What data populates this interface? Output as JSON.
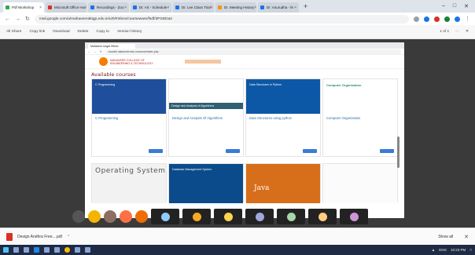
{
  "browser": {
    "tabs": [
      {
        "label": "Pdf Workshop",
        "color": "#34a853"
      },
      {
        "label": "Microsoft Office Hom",
        "color": "#d93025"
      },
      {
        "label": "Recordings - Zoo",
        "color": "#1a73e8"
      },
      {
        "label": "Dr. Art - Schedule",
        "color": "#1a73e8"
      },
      {
        "label": "Dr. Lee Class Trial",
        "color": "#1a73e8"
      },
      {
        "label": "Dr. Meeting History",
        "color": "#f29900"
      },
      {
        "label": "Dr. Anurudha - fe",
        "color": "#1a73e8"
      }
    ],
    "url": "mail.google.com/a/mahaveeraktgp.edu.in/u/0/#inbox/courseware/fsdf/3PSDDa2",
    "window_controls": [
      "–",
      "□",
      "✕"
    ]
  },
  "pdf_toolbar": {
    "items": [
      "All Share",
      "Copy link",
      "Download",
      "Delete",
      "Copy to",
      "Version history"
    ],
    "page_indicator": "1 of 1"
  },
  "shared_screen": {
    "inner_tab": "Mahaveer Ungar Ethnic",
    "inner_url": "moodle.mahaveer.edu.in/course/index.php",
    "org_name_line1": "MAHAVEER COLLEGE OF",
    "org_name_line2": "ENGINEERING & TECHNOLOGY",
    "section_title": "Available courses",
    "courses": [
      {
        "title": "C Programming",
        "image_text": "C Programming",
        "style": "c1"
      },
      {
        "title": "Design and Analysis Of Algorithms",
        "image_text": "Design and Analysis of Algorithms",
        "style": "c2"
      },
      {
        "title": "Data Structures using python",
        "image_text": "Data Structures in Python",
        "style": "c3"
      },
      {
        "title": "Computer Organization",
        "image_text": "Computer Organization",
        "style": "c4"
      },
      {
        "title": "",
        "image_text": "Operating System",
        "style": "c5"
      },
      {
        "title": "",
        "image_text": "Database Management System",
        "style": "c6"
      },
      {
        "title": "",
        "image_text": "Java",
        "style": "c7"
      },
      {
        "title": "",
        "image_text": "",
        "style": "c8"
      }
    ]
  },
  "participants": {
    "avatars": [
      {
        "icon": "video-icon",
        "color": "#555555"
      },
      {
        "icon": "avatar",
        "color": "#f4b400"
      },
      {
        "icon": "avatar",
        "color": "#8d6e63"
      },
      {
        "icon": "avatar",
        "color": "#ff7043"
      },
      {
        "icon": "avatar",
        "color": "#ef6c00"
      }
    ],
    "tiles": [
      {
        "color": "#90caf9"
      },
      {
        "color": "#f9a825"
      },
      {
        "color": "#ffd54f"
      },
      {
        "color": "#9fa8da"
      },
      {
        "color": "#a5d6a7"
      },
      {
        "color": "#ffcc80"
      },
      {
        "color": "#ce93d8"
      }
    ]
  },
  "downloads": {
    "file_name": "Design Andhra Free....pdf",
    "show_all": "Show all"
  },
  "taskbar": {
    "time": "10:23 PM",
    "lang": "ENG"
  }
}
